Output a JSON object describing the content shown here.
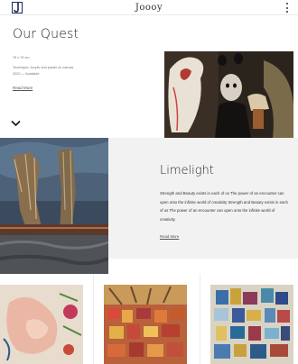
{
  "header": {
    "brand": "Joooy",
    "logo_icon": "brand-logo-icon",
    "menu_icon": "kebab-menu-icon"
  },
  "quest": {
    "title": "Our Quest",
    "dimensions": "76 x 76 cm",
    "technique": "Technique: Acrylic and pastel on canvas",
    "year": "2020 — Available",
    "read_more": "Read More",
    "scroll_icon": "chevron-down-icon"
  },
  "limelight": {
    "title": "Limelight",
    "text": "Strength and Beauty exists in each of us The power of an encounter can open onto the infinite world of creativity Strength and Beauty exists in each of us The power of an encounter can open onto the infinite world of creativity",
    "read_more": "Read More"
  },
  "colors": {
    "panel": "#f2f2f2",
    "text": "#222222",
    "muted": "#777777"
  }
}
